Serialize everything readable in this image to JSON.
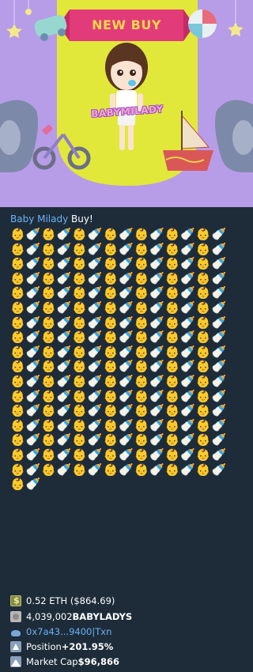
{
  "banner": {
    "title": "NEW BUY",
    "brand": "BABYMILADY",
    "colors": {
      "background": "#b79ce8",
      "card": "#e2e83a",
      "ribbon": "#e23b7a",
      "title": "#f7d84a"
    }
  },
  "message": {
    "token_link": "Baby Milady",
    "headline_suffix": " Buy!",
    "emoji_pattern": [
      "👶",
      "🍼"
    ],
    "emoji_count": 240,
    "stats": {
      "spent_amount": "0.52 ETH ($864.69)",
      "received_prefix": "4,039,002 ",
      "received_symbol": "BABYLADYS",
      "buyer_address": "0x7a43...9400",
      "separator": " | ",
      "txn_link": "Txn",
      "position_label": "Position ",
      "position_value": "+201.95%",
      "market_cap_label": "Market Cap ",
      "market_cap_value": "$96,866"
    },
    "icons": [
      "cash-icon",
      "coin-icon",
      "whale-icon",
      "up-arrow-icon",
      "mountain-icon"
    ],
    "colors": {
      "background": "#1e2c3a",
      "link": "#6ab2f2",
      "text": "#ffffff"
    }
  }
}
